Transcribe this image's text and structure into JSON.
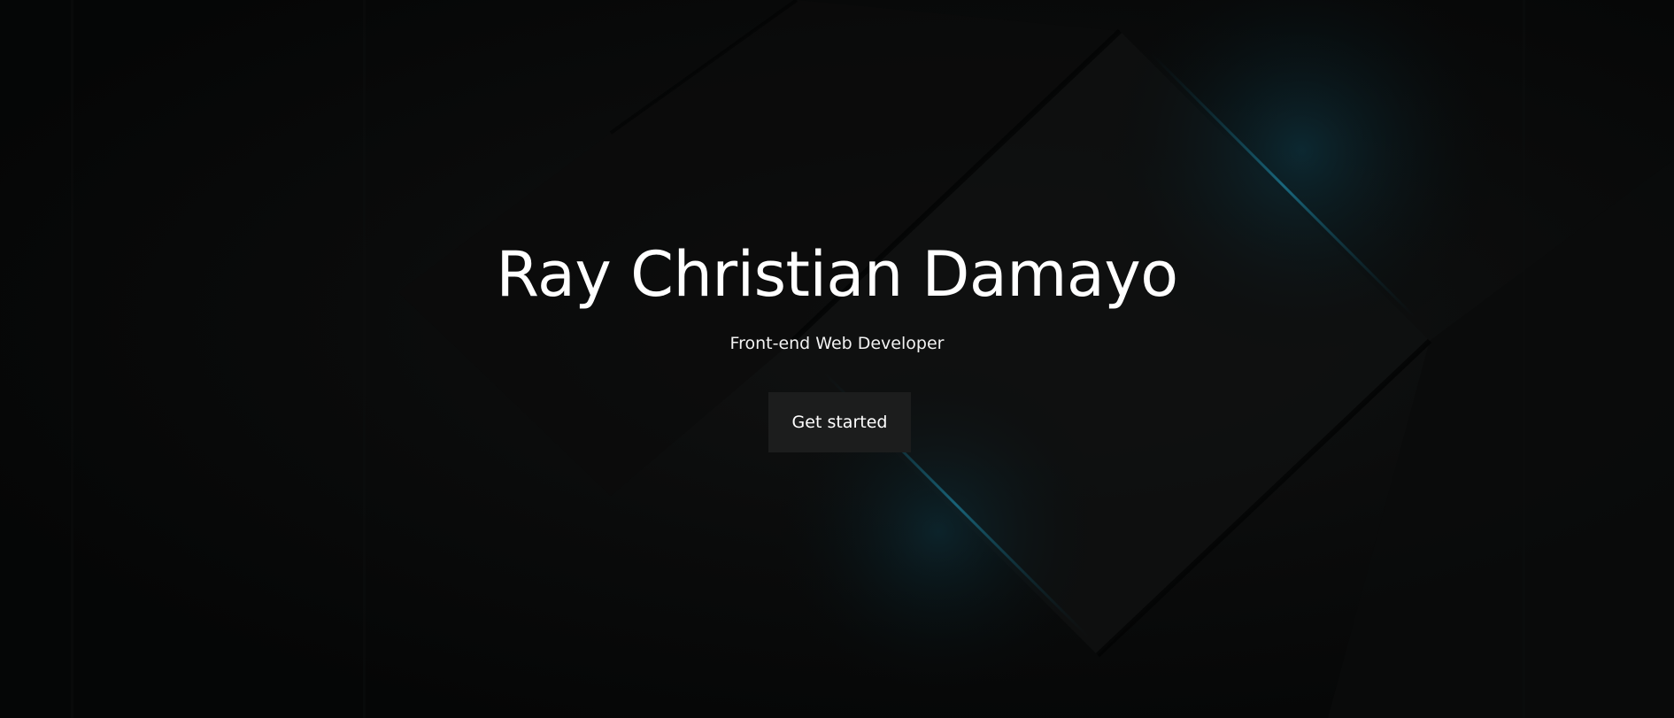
{
  "hero": {
    "title": "Ray Christian Damayo",
    "subtitle": "Front-end Web Developer",
    "cta_label": "Get started"
  },
  "theme": {
    "background": "#050606",
    "accent_glow": "#0e6b84",
    "button_bg": "#1c1d1d",
    "text": "#ffffff"
  }
}
